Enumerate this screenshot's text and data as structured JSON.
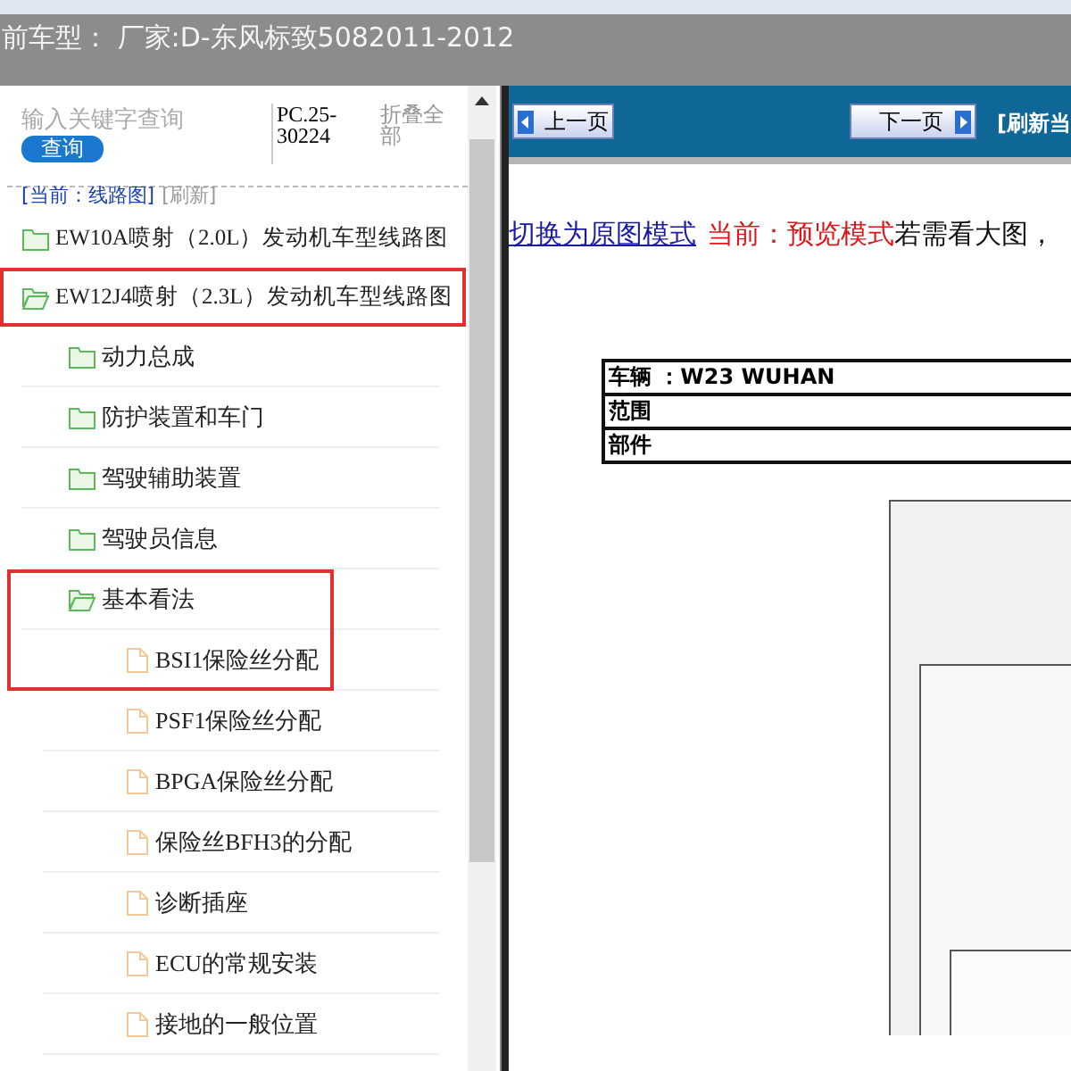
{
  "header": {
    "title": "前车型： 厂家:D-东风标致5082011-2012"
  },
  "sidebar": {
    "search": {
      "placeholder": "输入关键字查询",
      "button": "查询"
    },
    "code": "PC.25-30224",
    "collapse_all": "折叠全部",
    "current": "[当前：线路图]",
    "refresh": "[刷新]",
    "tree": [
      {
        "label": "EW10A喷射（2.0L）发动机车型线路图",
        "kind": "folder",
        "expanded": false,
        "highlighted": false
      },
      {
        "label": "EW12J4喷射（2.3L）发动机车型线路图",
        "kind": "folder",
        "expanded": true,
        "highlighted": true,
        "children": [
          {
            "label": "动力总成",
            "kind": "folder",
            "expanded": false,
            "highlighted": false
          },
          {
            "label": "防护装置和车门",
            "kind": "folder",
            "expanded": false,
            "highlighted": false
          },
          {
            "label": "驾驶辅助装置",
            "kind": "folder",
            "expanded": false,
            "highlighted": false
          },
          {
            "label": "驾驶员信息",
            "kind": "folder",
            "expanded": false,
            "highlighted": false
          },
          {
            "label": "基本看法",
            "kind": "folder",
            "expanded": true,
            "highlighted": true,
            "children": [
              {
                "label": "BSI1保险丝分配",
                "kind": "file",
                "highlighted": true
              },
              {
                "label": "PSF1保险丝分配",
                "kind": "file",
                "highlighted": false
              },
              {
                "label": "BPGA保险丝分配",
                "kind": "file",
                "highlighted": false
              },
              {
                "label": "保险丝BFH3的分配",
                "kind": "file",
                "highlighted": false
              },
              {
                "label": "诊断插座",
                "kind": "file",
                "highlighted": false
              },
              {
                "label": "ECU的常规安装",
                "kind": "file",
                "highlighted": false
              },
              {
                "label": "接地的一般位置",
                "kind": "file",
                "highlighted": false
              }
            ]
          }
        ]
      }
    ]
  },
  "toolbar": {
    "prev": "上一页",
    "next": "下一页",
    "refresh": "[刷新当"
  },
  "content": {
    "mode_link": "切换为原图模式",
    "mode_current": "当前：预览模式",
    "hint": "若需看大图，",
    "info_table": [
      {
        "label": "车辆 ：W23 WUHAN"
      },
      {
        "label": "范围"
      },
      {
        "label": "部件"
      }
    ]
  }
}
